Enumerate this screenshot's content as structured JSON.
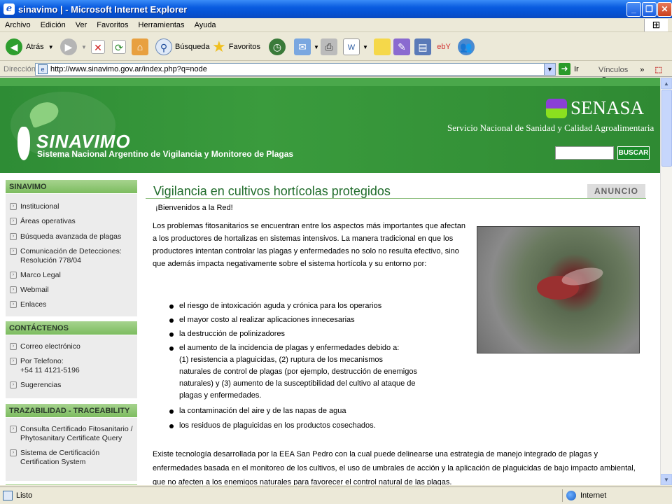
{
  "window": {
    "title": "sinavimo | - Microsoft Internet Explorer",
    "controls": {
      "minimize": "_",
      "maximize": "❐",
      "close": "✕"
    }
  },
  "menu": [
    "Archivo",
    "Edición",
    "Ver",
    "Favoritos",
    "Herramientas",
    "Ayuda"
  ],
  "toolbar": {
    "back": "Atrás",
    "search": "Búsqueda",
    "favorites": "Favoritos"
  },
  "address": {
    "label": "Dirección",
    "url": "http://www.sinavimo.gov.ar/index.php?q=node",
    "go": "Ir",
    "links": "Vínculos"
  },
  "header": {
    "logo_title": "SINAVIMO",
    "logo_subtitle": "Sistema Nacional Argentino de Vigilancia y Monitoreo de Plagas",
    "senasa_name": "SENASA",
    "senasa_subtitle": "Servicio Nacional de Sanidad y Calidad Agroalimentaria",
    "search_button": "BUSCAR",
    "search_value": ""
  },
  "sidebar": {
    "sections": [
      {
        "title": "SINAVIMO",
        "items": [
          "Institucional",
          "Áreas operativas",
          "Búsqueda avanzada de plagas",
          "Comunicación de Detecciones:\nResolución 778/04",
          "Marco Legal",
          "Webmail",
          "Enlaces"
        ]
      },
      {
        "title": "CONTÁCTENOS",
        "items": [
          "Correo electrónico",
          "Por Telefono:\n+54 11 4121-5196",
          "Sugerencias"
        ]
      },
      {
        "title": "TRAZABILIDAD - TRACEABILITY",
        "items": [
          "Consulta Certificado Fitosanitario /\nPhytosanitary Certificate Query",
          "Sistema de Certificación\nCertification System"
        ]
      }
    ]
  },
  "main": {
    "title": "Vigilancia en cultivos hortícolas protegidos",
    "badge": "ANUNCIO",
    "welcome": "¡Bienvenidos a la Red!",
    "intro": "Los problemas fitosanitarios se encuentran entre los aspectos más importantes que afectan a los productores de hortalizas en sistemas intensivos. La manera tradicional en que los productores intentan controlar las plagas y enfermedades no solo no resulta efectivo, sino que además impacta negativamente sobre el sistema hortícola y su entorno por:",
    "bullets": [
      "el riesgo de intoxicación aguda y crónica para los operarios",
      "el mayor costo al realizar aplicaciones innecesarias",
      "la destrucción de polinizadores",
      "el aumento de la incidencia de plagas y enfermedades debido a:\n(1) resistencia a plaguicidas, (2) ruptura de los mecanismos\nnaturales de control de plagas (por ejemplo, destrucción de enemigos\nnaturales) y (3) aumento de la susceptibilidad del cultivo al ataque de\nplagas y enfermedades.",
      "la contaminación del aire y de las napas de agua",
      "los residuos de plaguicidas en los productos cosechados."
    ],
    "closing": "Existe tecnología desarrollada por la EEA San Pedro con la cual puede delinearse una estrategia de manejo integrado de plagas y enfermedades basada en el monitoreo de los cultivos, el uso de umbrales de acción y la aplicación de plaguicidas de bajo impacto ambiental, que no afecten a los enemigos naturales para favorecer el control natural de las plagas."
  },
  "status": {
    "text": "Listo",
    "zone": "Internet"
  }
}
